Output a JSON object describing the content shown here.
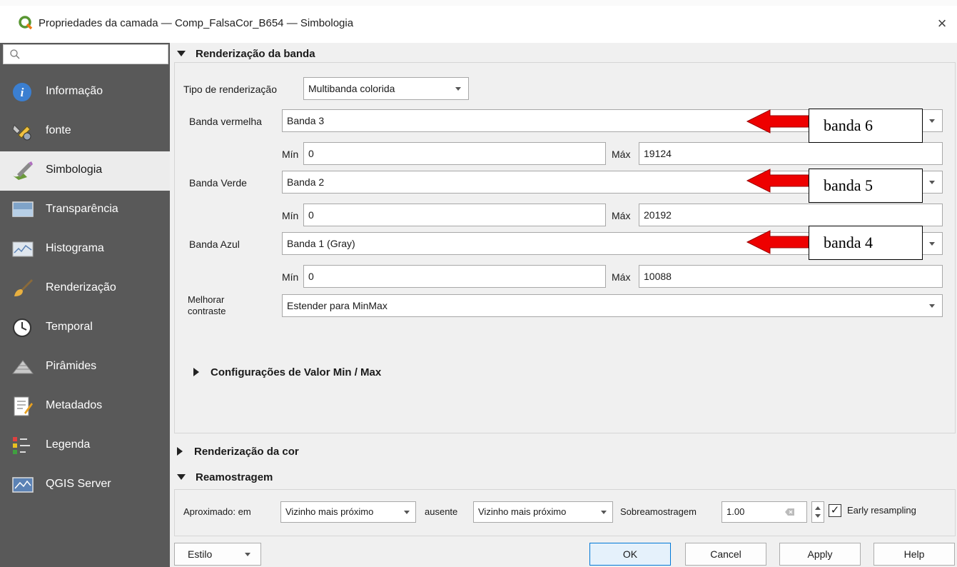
{
  "window": {
    "title": "Propriedades da camada — Comp_FalsaCor_B654 — Simbologia",
    "close_glyph": "×"
  },
  "sidebar": {
    "search_placeholder": "",
    "items": [
      {
        "label": "Informação",
        "icon": "info-icon"
      },
      {
        "label": "fonte",
        "icon": "source-tools-icon"
      },
      {
        "label": "Simbologia",
        "icon": "paint-brush-icon",
        "active": true
      },
      {
        "label": "Transparência",
        "icon": "transparency-icon"
      },
      {
        "label": "Histograma",
        "icon": "histogram-icon"
      },
      {
        "label": "Renderização",
        "icon": "render-brush-icon"
      },
      {
        "label": "Temporal",
        "icon": "clock-icon"
      },
      {
        "label": "Pirâmides",
        "icon": "pyramid-icon"
      },
      {
        "label": "Metadados",
        "icon": "metadata-icon"
      },
      {
        "label": "Legenda",
        "icon": "legend-icon"
      },
      {
        "label": "QGIS Server",
        "icon": "server-icon"
      }
    ]
  },
  "band_rendering": {
    "header": "Renderização da banda",
    "render_type_label": "Tipo de renderização",
    "render_type_value": "Multibanda colorida",
    "red": {
      "label": "Banda vermelha",
      "value": "Banda 3",
      "min_label": "Mín",
      "min": "0",
      "max_label": "Máx",
      "max": "19124"
    },
    "green": {
      "label": "Banda Verde",
      "value": "Banda 2",
      "min_label": "Mín",
      "min": "0",
      "max_label": "Máx",
      "max": "20192"
    },
    "blue": {
      "label": "Banda Azul",
      "value": "Banda 1 (Gray)",
      "min_label": "Mín",
      "min": "0",
      "max_label": "Máx",
      "max": "10088"
    },
    "contrast_label_line1": "Melhorar",
    "contrast_label_line2": "contraste",
    "contrast_value": "Estender para MinMax",
    "minmax_settings_header": "Configurações de Valor Min / Max"
  },
  "annotations": {
    "red_callout": "banda 6",
    "green_callout": "banda 5",
    "blue_callout": "banda 4",
    "arrow_color": "#ee0000"
  },
  "color_rendering": {
    "header": "Renderização da cor"
  },
  "resampling": {
    "header": "Reamostragem",
    "zoomed_in_label": "Aproximado: em",
    "zoomed_in_value": "Vizinho mais próximo",
    "zoomed_out_label": "ausente",
    "zoomed_out_value": "Vizinho mais próximo",
    "oversampling_label": "Sobreamostragem",
    "oversampling_value": "1.00",
    "early_resampling_label": "Early resampling",
    "early_resampling_checked": true
  },
  "footer": {
    "style_label": "Estilo",
    "ok_label": "OK",
    "cancel_label": "Cancel",
    "apply_label": "Apply",
    "help_label": "Help"
  },
  "colors": {
    "sidebar_bg": "#595959",
    "panel_bg": "#f0f0f0",
    "qgis_green": "#589632"
  }
}
